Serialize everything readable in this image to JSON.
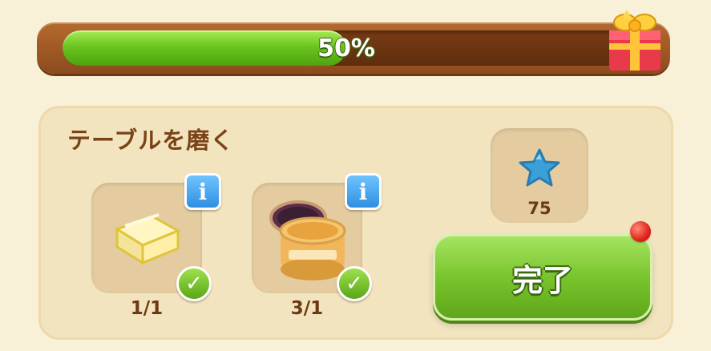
{
  "progress": {
    "value": 0.5,
    "label": "50%"
  },
  "task": {
    "title": "テーブルを磨く",
    "items": [
      {
        "icon": "cloth-icon",
        "count": "1/1"
      },
      {
        "icon": "polish-jar-icon",
        "count": "3/1"
      }
    ],
    "info_label": "i",
    "check_label": "✓"
  },
  "reward": {
    "icon": "blue-star-icon",
    "value": "75"
  },
  "complete_button": {
    "label": "完了"
  },
  "colors": {
    "progress_fill": "#6cc51f",
    "button_green": "#79c52d",
    "title_brown": "#7a4316",
    "info_blue": "#2f8fe0",
    "notification_red": "#e0241a"
  }
}
